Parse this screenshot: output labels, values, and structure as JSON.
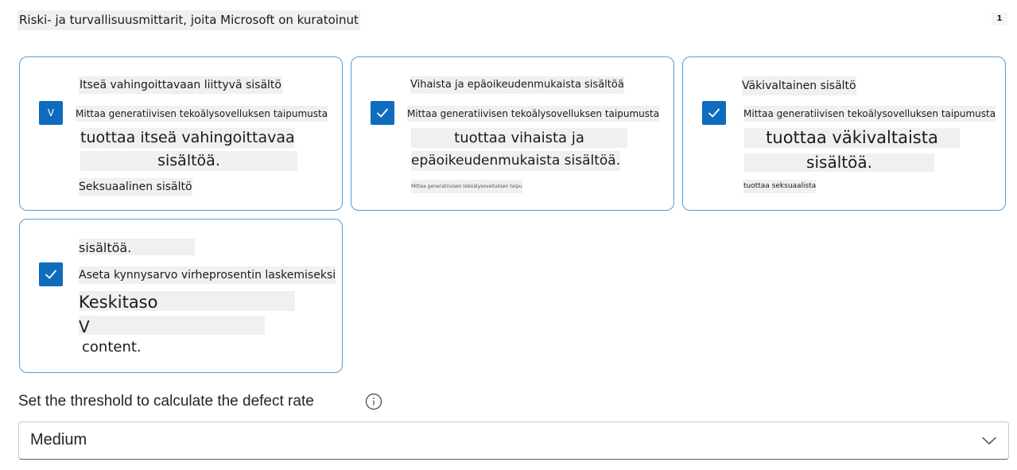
{
  "header": {
    "title": "Riski- ja turvallisuusmittarit, joita Microsoft on kuratoinut",
    "count": "1"
  },
  "cards": [
    {
      "title": "Itseä vahingoittavaan liittyvä sisältö",
      "checkbox_mark": "V",
      "desc_line1": "Mittaa generatiivisen tekoälysovelluksen taipumusta",
      "big_line1": "tuottaa itseä vahingoittavaa",
      "big_line2": "sisältöä.",
      "footer": "Seksuaalinen sisältö"
    },
    {
      "title": "Vihaista ja epäoikeudenmukaista sisältöä",
      "desc_line1": "Mittaa generatiivisen tekoälysovelluksen taipumusta",
      "big_line1": "tuottaa vihaista ja",
      "big_line2": "epäoikeudenmukaista sisältöä.",
      "footer": "Mittaa generatiivisen tekoälysovelluksen taipumusta"
    },
    {
      "title": "Väkivaltainen sisältö",
      "desc_line1": "Mittaa generatiivisen tekoälysovelluksen taipumusta",
      "big_line1": "tuottaa väkivaltaista",
      "big_line2": "sisältöä.",
      "footer": "tuottaa seksuaalista"
    },
    {
      "title": "sisältöä.",
      "desc_line1": "Aseta kynnysarvo virheprosentin laskemiseksi",
      "big_line1": "Keskitaso",
      "big_line2": "V",
      "footer": "content."
    }
  ],
  "threshold": {
    "label": "Set the threshold to calculate the defect rate",
    "selected": "Medium"
  },
  "colors": {
    "accent": "#0f6cbd",
    "card_border": "#5b9bd5",
    "highlight": "#f0f0f0"
  },
  "icons": {
    "checkbox": "checkmark-icon",
    "info": "info-icon",
    "dropdown": "chevron-down-icon"
  }
}
